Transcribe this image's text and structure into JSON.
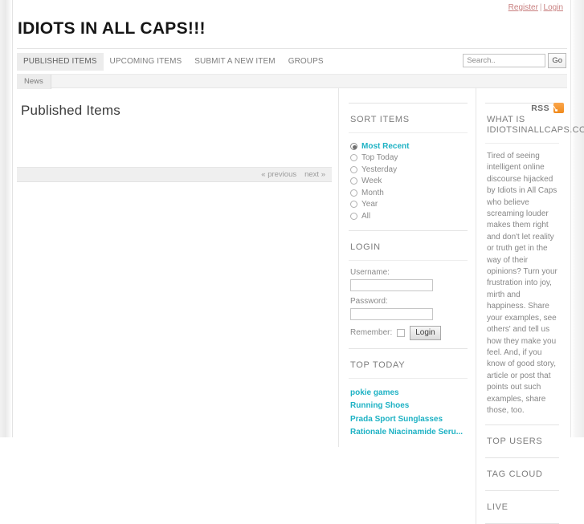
{
  "utility": {
    "register_label": "Register",
    "separator": "|",
    "login_label": "Login"
  },
  "site": {
    "title": "IDIOTS IN ALL CAPS!!!"
  },
  "nav": {
    "items": [
      {
        "label": "PUBLISHED ITEMS",
        "active": true
      },
      {
        "label": "UPCOMING ITEMS",
        "active": false
      },
      {
        "label": "SUBMIT A NEW ITEM",
        "active": false
      },
      {
        "label": "GROUPS",
        "active": false
      }
    ]
  },
  "search": {
    "value": "",
    "placeholder": "Search..",
    "button_label": "Go"
  },
  "subnav": {
    "items": [
      {
        "label": "News",
        "active": true
      }
    ]
  },
  "main": {
    "page_title": "Published Items",
    "rss_label": "RSS",
    "rss_icon": "rss-feed-icon",
    "pager": {
      "previous_label": "« previous",
      "next_label": "next »"
    }
  },
  "sort_block": {
    "heading": "SORT ITEMS",
    "options": [
      {
        "label": "Most Recent",
        "selected": true
      },
      {
        "label": "Top Today",
        "selected": false
      },
      {
        "label": "Yesterday",
        "selected": false
      },
      {
        "label": "Week",
        "selected": false
      },
      {
        "label": "Month",
        "selected": false
      },
      {
        "label": "Year",
        "selected": false
      },
      {
        "label": "All",
        "selected": false
      }
    ]
  },
  "login_block": {
    "heading": "LOGIN",
    "username_label": "Username:",
    "username_value": "",
    "password_label": "Password:",
    "password_value": "",
    "remember_label": "Remember:",
    "remember_checked": false,
    "submit_label": "Login"
  },
  "top_today_block": {
    "heading": "TOP TODAY",
    "links": [
      "pokie games",
      "Running Shoes",
      "Prada Sport Sunglasses",
      "Rationale Niacinamide Seru..."
    ]
  },
  "about_block": {
    "heading": "WHAT IS IDIOTSINALLCAPS.COM?",
    "body": "Tired of seeing intelligent online discourse hijacked by Idiots in All Caps who believe screaming louder makes them right and don't let reality or truth get in the way of their opinions? Turn your frustration into joy, mirth and happiness. Share your examples, see others' and tell us how they make you feel. And, if you know of good story, article or post that points out such examples, share those, too."
  },
  "right_blocks": {
    "top_users": "TOP USERS",
    "tag_cloud": "TAG CLOUD",
    "live": "LIVE"
  },
  "colors": {
    "accent_teal": "#1eb2c4",
    "link_red": "#c87f7f",
    "rss_orange": "#f08a1c",
    "text_gray": "#878787"
  }
}
